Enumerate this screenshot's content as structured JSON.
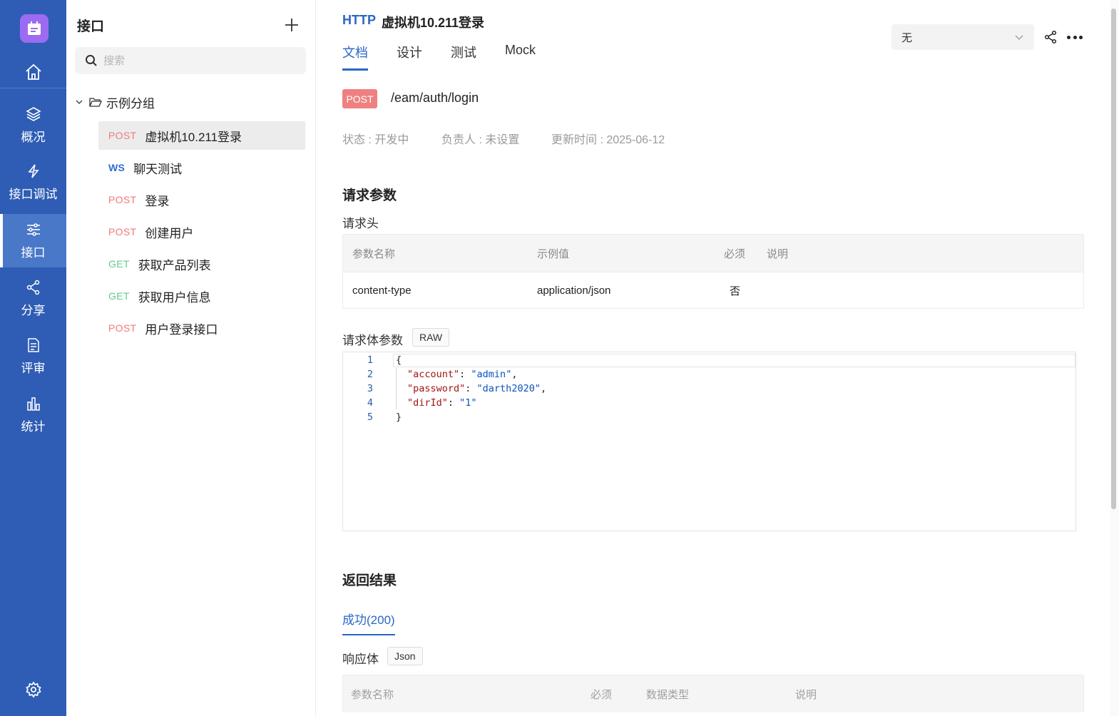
{
  "rail": {
    "items": [
      {
        "label": "概况"
      },
      {
        "label": "接口调试"
      },
      {
        "label": "接口"
      },
      {
        "label": "分享"
      },
      {
        "label": "评审"
      },
      {
        "label": "统计"
      }
    ],
    "active": "接口",
    "colors": {
      "background": "#2f5db5",
      "active": "#4a78c8",
      "logo": "#9b6cf2"
    }
  },
  "sidebar": {
    "title": "接口",
    "search_placeholder": "搜索",
    "group": "示例分组",
    "apis": [
      {
        "method": "POST",
        "name": "虚拟机10.211登录",
        "active": true
      },
      {
        "method": "WS",
        "name": "聊天测试"
      },
      {
        "method": "POST",
        "name": "登录"
      },
      {
        "method": "POST",
        "name": "创建用户"
      },
      {
        "method": "GET",
        "name": "获取产品列表"
      },
      {
        "method": "GET",
        "name": "获取用户信息"
      },
      {
        "method": "POST",
        "name": "用户登录接口"
      }
    ]
  },
  "main": {
    "protocol": "HTTP",
    "title": "虚拟机10.211登录",
    "tabs": [
      "文档",
      "设计",
      "测试",
      "Mock"
    ],
    "active_tab": "文档",
    "env_select": "无",
    "method": "POST",
    "path": "/eam/auth/login",
    "status": "状态 : 开发中",
    "owner": "负责人 : 未设置",
    "updated": "更新时间 : 2025-06-12",
    "request_params_heading": "请求参数",
    "headers_heading": "请求头",
    "headers_table": {
      "columns": [
        "参数名称",
        "示例值",
        "必须",
        "说明"
      ],
      "rows": [
        {
          "name": "content-type",
          "example": "application/json",
          "required": "否",
          "desc": ""
        }
      ]
    },
    "body_heading": "请求体参数",
    "body_format": "RAW",
    "body_code": {
      "line_numbers": [
        "1",
        "2",
        "3",
        "4",
        "5"
      ],
      "lines": [
        {
          "parts": [
            {
              "t": "{",
              "c": "p"
            }
          ]
        },
        {
          "parts": [
            {
              "t": "\"account\"",
              "c": "k"
            },
            {
              "t": ": ",
              "c": "p"
            },
            {
              "t": "\"admin\"",
              "c": "s"
            },
            {
              "t": ",",
              "c": "p"
            }
          ]
        },
        {
          "parts": [
            {
              "t": "\"password\"",
              "c": "k"
            },
            {
              "t": ": ",
              "c": "p"
            },
            {
              "t": "\"darth2020\"",
              "c": "s"
            },
            {
              "t": ",",
              "c": "p"
            }
          ]
        },
        {
          "parts": [
            {
              "t": "\"dirId\"",
              "c": "k"
            },
            {
              "t": ": ",
              "c": "p"
            },
            {
              "t": "\"1\"",
              "c": "s"
            }
          ]
        },
        {
          "parts": [
            {
              "t": "}",
              "c": "p"
            }
          ]
        }
      ]
    },
    "response_heading": "返回结果",
    "response_tab": "成功(200)",
    "response_body_heading": "响应体",
    "response_format": "Json",
    "response_table": {
      "columns": [
        "参数名称",
        "必须",
        "数据类型",
        "说明"
      ]
    },
    "colors": {
      "accent": "#2b66c6",
      "post": "#f08080",
      "get": "#66c98c",
      "ws": "#2b6fd6"
    }
  }
}
